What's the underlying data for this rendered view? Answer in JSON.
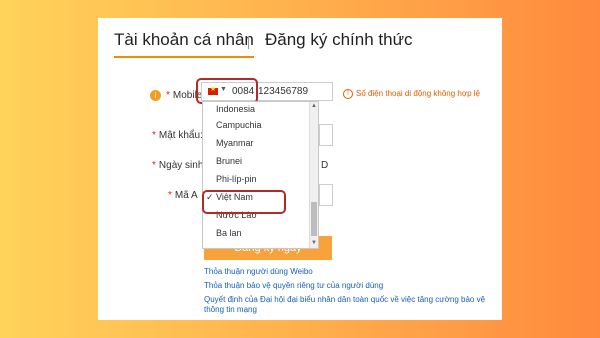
{
  "tabs": {
    "active": "Tài khoản cá nhân",
    "other": "Đăng ký chính thức"
  },
  "form": {
    "mobile_label": "Mobile:",
    "password_label": "Mật khẩu:",
    "dob_label": "Ngày sinh:",
    "code_label": "Mã A",
    "country_prefix": "0084",
    "phone_value": "123456789",
    "error_message": "Số điện thoại di động không hợp lệ",
    "dob_suffix": "D",
    "submit_label": "Đăng ký ngay"
  },
  "dropdown": {
    "items": [
      "Indonesia",
      "Campuchia",
      "Myanmar",
      "Brunei",
      "Phi-líp-pin",
      "Việt Nam",
      "Nước Lào",
      "Ba lan"
    ],
    "selected": "Việt Nam"
  },
  "links": {
    "weibo": "Thỏa thuận người dùng Weibo",
    "privacy": "Thỏa thuận bảo vệ quyền riêng tư của người dùng",
    "decision_line1": "Quyết định của Đại hội đại biểu nhân dân toàn quốc về việc tăng cường bảo vệ",
    "decision_line2": "thông tin mạng"
  },
  "colors": {
    "accent": "#f7a23a",
    "error": "#e06000",
    "highlight_border": "#b22a2a",
    "link": "#1a5fb4"
  },
  "icons": {
    "flag": "vietnam-flag-icon",
    "info": "info-icon",
    "error": "error-icon",
    "check": "checkmark-icon"
  }
}
